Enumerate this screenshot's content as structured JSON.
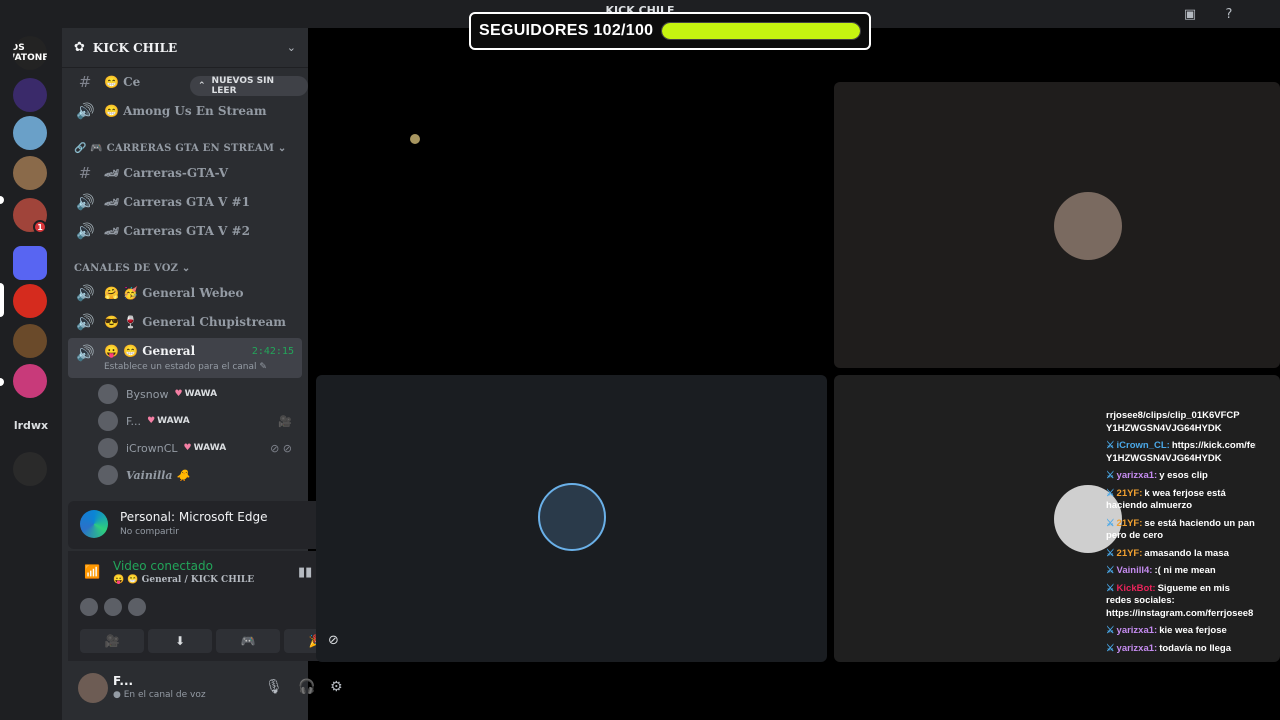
{
  "titlebar": {
    "title": "KICK CHILE",
    "icons": [
      "screen-share-status-icon",
      "help-icon"
    ]
  },
  "followers": {
    "label": "SEGUIDORES 102/100",
    "progress": 1.0,
    "color": "#c6f410"
  },
  "rail": {
    "servers": [
      {
        "name": "los-watones-server",
        "text": "LOS WATONES",
        "color": "#232323"
      },
      {
        "name": "purple-server",
        "text": "",
        "color": "#3a2a6a"
      },
      {
        "name": "landscape-server",
        "text": "",
        "color": "#6aa0c8"
      },
      {
        "name": "horse-server",
        "text": "",
        "color": "#8a6a4a"
      },
      {
        "name": "streamer-server",
        "text": "",
        "color": "#a0443a",
        "badge": "1"
      },
      {
        "name": "folder-server",
        "text": "",
        "color": "#5865f2"
      },
      {
        "name": "chile-flag-server",
        "text": "",
        "color": "#d52b1e"
      },
      {
        "name": "soldier-server",
        "text": "",
        "color": "#6a4a2a"
      },
      {
        "name": "pink-server",
        "text": "",
        "color": "#c83a7a"
      },
      {
        "name": "pokeball-server",
        "text": "",
        "color": "#2a2a2a"
      }
    ],
    "text_server": "lrdwx"
  },
  "server": {
    "name": "KICK CHILE"
  },
  "unread_pill": "NUEVOS SIN LEER",
  "channels": [
    {
      "type": "text",
      "icon": "hash-icon",
      "label": "😁 Ce"
    },
    {
      "type": "voice",
      "icon": "speaker-icon",
      "label": "😁 Among Us En Stream"
    }
  ],
  "categories": {
    "gta": "🔗 🎮 CARRERAS GTA EN STREAM ⌄",
    "voice": "CANALES DE VOZ ⌄"
  },
  "gta_channels": [
    {
      "type": "text",
      "icon": "hash-icon",
      "label": "🏎 Carreras-GTA-V"
    },
    {
      "type": "voice",
      "icon": "speaker-icon",
      "label": "🏎 Carreras GTA V #1"
    },
    {
      "type": "voice",
      "icon": "speaker-icon",
      "label": "🏎 Carreras GTA V #2"
    }
  ],
  "voice_channels": [
    {
      "type": "voice",
      "icon": "speaker-icon",
      "label": "🤗 🥳 General Webeo"
    },
    {
      "type": "voice",
      "icon": "speaker-icon",
      "label": "😎 🍷 General Chupistream"
    }
  ],
  "active_channel": {
    "label": "😛 😁 General",
    "time": "2:42:15",
    "status": "Establece un estado para el canal ✎"
  },
  "voice_users": [
    {
      "name": "Bysnow",
      "tag": "WAWA",
      "right": ""
    },
    {
      "name": "F...",
      "tag": "WAWA",
      "right": "🎥"
    },
    {
      "name": "iCrownCL",
      "tag": "WAWA",
      "right": "⊘ ⊘"
    },
    {
      "name": "Vainilla 🐥",
      "tag": "",
      "right": ""
    }
  ],
  "share_panel": {
    "title": "Personal: Microsoft Edge",
    "subtitle": "No compartir"
  },
  "voice_panel": {
    "title": "Video conectado",
    "subtitle": "😛 😁 General / KICK CHILE",
    "buttons": [
      "🎥",
      "⬇",
      "🎮",
      "🎉"
    ],
    "button_colors": [
      "#23a55a",
      "#dbdee1",
      "#dbdee1",
      "#dbdee1"
    ]
  },
  "user_panel": {
    "name": "F...",
    "status": "● En el canal de voz"
  },
  "tiles": [
    {
      "name": "tile-1",
      "avatar_color": ""
    },
    {
      "name": "tile-2",
      "avatar_color": "#7a6a60"
    },
    {
      "name": "tile-3",
      "avatar_color": "#2a3a4a"
    },
    {
      "name": "tile-4",
      "avatar_color": "#cfcfcf"
    }
  ],
  "chat": [
    {
      "user": "",
      "user_color": "#fff",
      "text": "rrjosee8/clips/clip_01K6VFCP Y1HZWGSN4VJG64HYDK"
    },
    {
      "user": "iCrown_CL:",
      "user_color": "#4aa8e8",
      "text": "https://kick.com/ferrjosee8/clips/clip_01K6VFCP Y1HZWGSN4VJG64HYDK"
    },
    {
      "user": "yarizxa1:",
      "user_color": "#c58cf0",
      "text": "y esos clip"
    },
    {
      "user": "21YF:",
      "user_color": "#f0a030",
      "text": "k wea ferjose está haciendo almuerzo"
    },
    {
      "user": "21YF:",
      "user_color": "#f0a030",
      "text": "se está haciendo un pan pero de cero"
    },
    {
      "user": "21YF:",
      "user_color": "#f0a030",
      "text": "amasando la masa"
    },
    {
      "user": "Vainill4:",
      "user_color": "#c58cf0",
      "text": ":( ni me mean"
    },
    {
      "user": "KickBot:",
      "user_color": "#e8245a",
      "text": "Sigueme en mis redes sociales: https://instagram.com/ferrjosee8"
    },
    {
      "user": "yarizxa1:",
      "user_color": "#c58cf0",
      "text": "kie wea ferjose"
    },
    {
      "user": "yarizxa1:",
      "user_color": "#c58cf0",
      "text": "todavía no llega"
    }
  ]
}
